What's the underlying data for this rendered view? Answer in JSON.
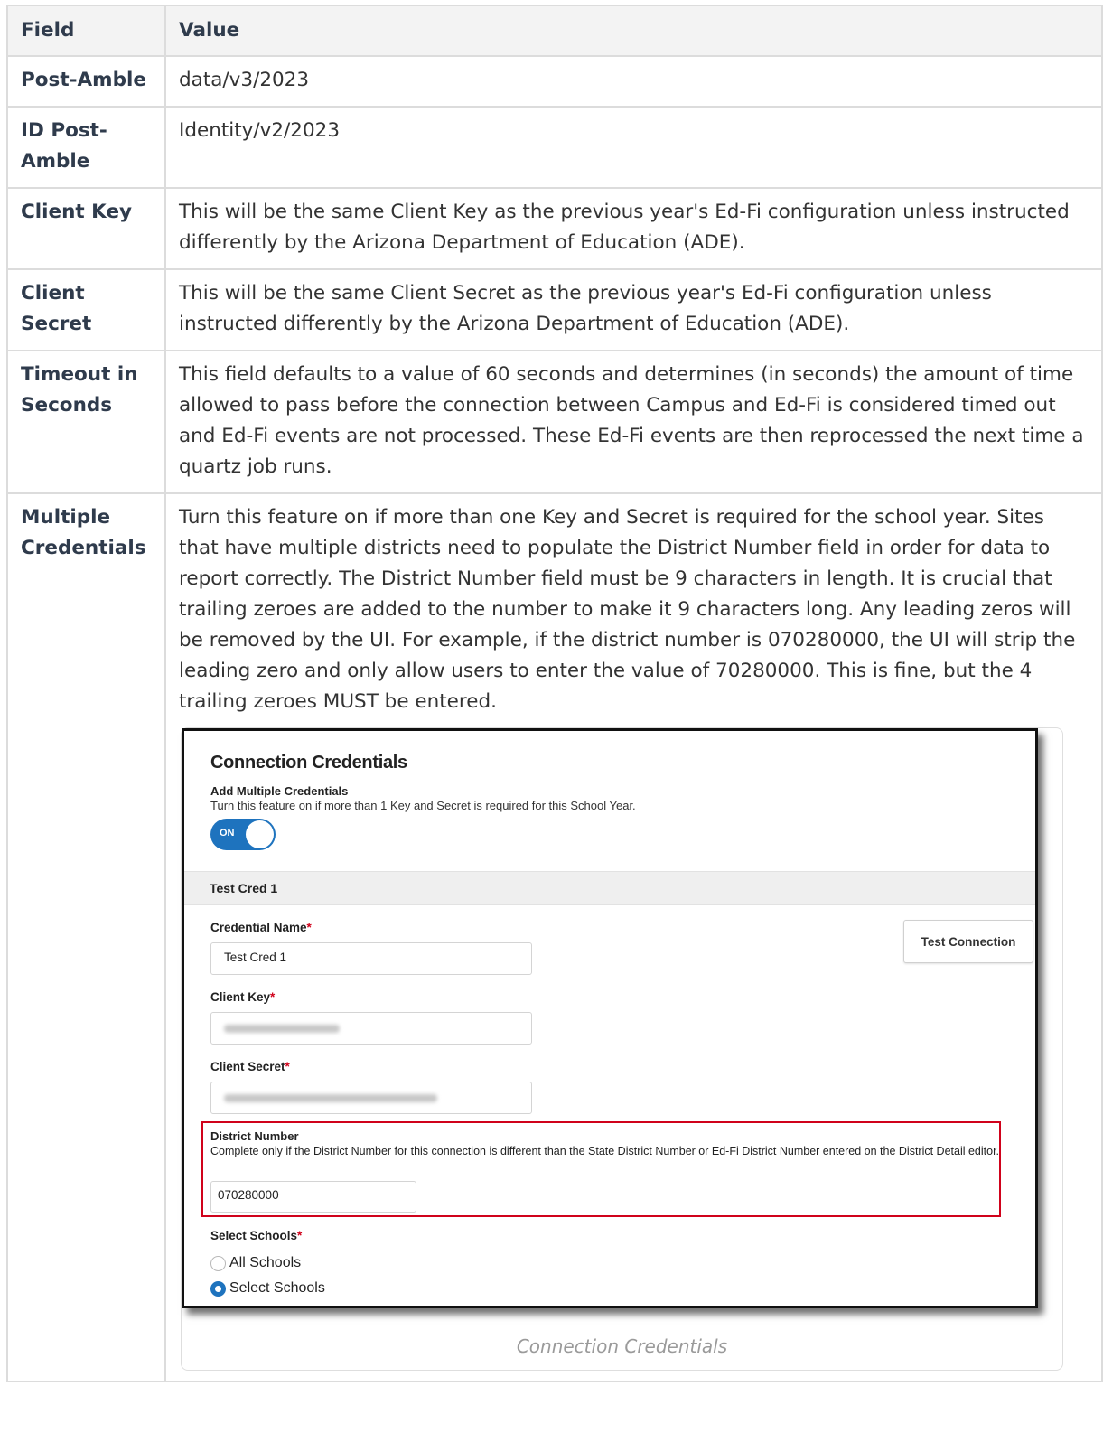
{
  "table": {
    "header_field": "Field",
    "header_value": "Value",
    "rows": [
      {
        "field": "Post-Amble",
        "value": "data/v3/2023"
      },
      {
        "field": "ID Post-Amble",
        "value": "Identity/v2/2023"
      },
      {
        "field": "Client Key",
        "value": "This will be the same Client Key as the previous year's Ed-Fi configuration unless instructed differently by the Arizona Department of Education (ADE)."
      },
      {
        "field": "Client Secret",
        "value": "This will be the same Client Secret as the previous year's Ed-Fi configuration unless instructed differently by the Arizona Department of Education (ADE)."
      },
      {
        "field": "Timeout in Seconds",
        "value": "This field defaults to a value of 60 seconds and determines (in seconds) the amount of time allowed to pass before the connection between Campus and Ed-Fi is considered timed out and Ed-Fi events are not processed. These Ed-Fi events are then reprocessed the next time a quartz job runs."
      },
      {
        "field": "Multiple Credentials",
        "value": "Turn this feature on if more than one Key and Secret is required for the school year. Sites that have multiple districts need to populate the District Number field in order for data to report correctly. The District Number field must be 9 characters in length. It is crucial that trailing zeroes are added to the number to make it 9 characters long. Any leading zeros will be removed by the UI. For example, if the district number is 070280000, the UI will strip the leading zero and only allow users to enter the value of 70280000. This is fine, but the 4 trailing zeroes MUST be entered."
      }
    ]
  },
  "screenshot": {
    "title": "Connection Credentials",
    "toggle_heading": "Add Multiple Credentials",
    "toggle_description": "Turn this feature on if more than 1 Key and Secret is required for this School Year.",
    "toggle_state": "ON",
    "section_label": "Test Cred 1",
    "credential_name_label": "Credential Name",
    "credential_name_value": "Test Cred 1",
    "client_key_label": "Client Key",
    "client_secret_label": "Client Secret",
    "required_marker": "*",
    "test_button": "Test Connection",
    "district_number_label": "District Number",
    "district_number_help": "Complete only if the District Number for this connection is different than the State District Number or Ed-Fi District Number entered on the District Detail editor.",
    "district_number_value": "070280000",
    "select_schools_label": "Select Schools",
    "radio_all": "All Schools",
    "radio_select": "Select Schools",
    "accent_color": "#1e73be",
    "highlight_color": "#d0021b"
  },
  "caption": "Connection Credentials"
}
